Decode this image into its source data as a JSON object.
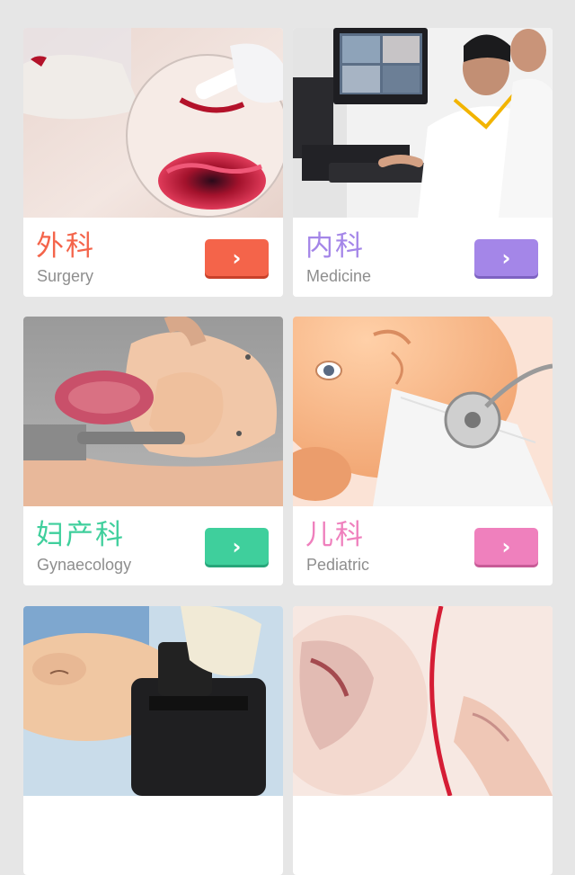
{
  "cards": [
    {
      "title_cn": "外科",
      "title_en": "Surgery",
      "button_icon": "chevron-right-icon",
      "color": "#f4644a",
      "button_color": "#f4644a",
      "button_shadow": "#c9412a",
      "image": "surgical-wound-model"
    },
    {
      "title_cn": "内科",
      "title_en": "Medicine",
      "button_icon": "chevron-right-icon",
      "color": "#a486e8",
      "button_color": "#a486e8",
      "button_shadow": "#7d62c2",
      "image": "doctors-at-computer"
    },
    {
      "title_cn": "妇产科",
      "title_en": "Gynaecology",
      "button_icon": "chevron-right-icon",
      "color": "#3fcf9c",
      "button_color": "#3fcf9c",
      "button_shadow": "#27a67a",
      "image": "birthing-simulator"
    },
    {
      "title_cn": "儿科",
      "title_en": "Pediatric",
      "button_icon": "chevron-right-icon",
      "color": "#ef80bd",
      "button_color": "#ef80bd",
      "button_shadow": "#c85b97",
      "image": "infant-manikin-stethoscope"
    },
    {
      "title_cn": "",
      "title_en": "",
      "image": "cpr-manikin"
    },
    {
      "title_cn": "",
      "title_en": "",
      "image": "infant-airway-model"
    }
  ]
}
